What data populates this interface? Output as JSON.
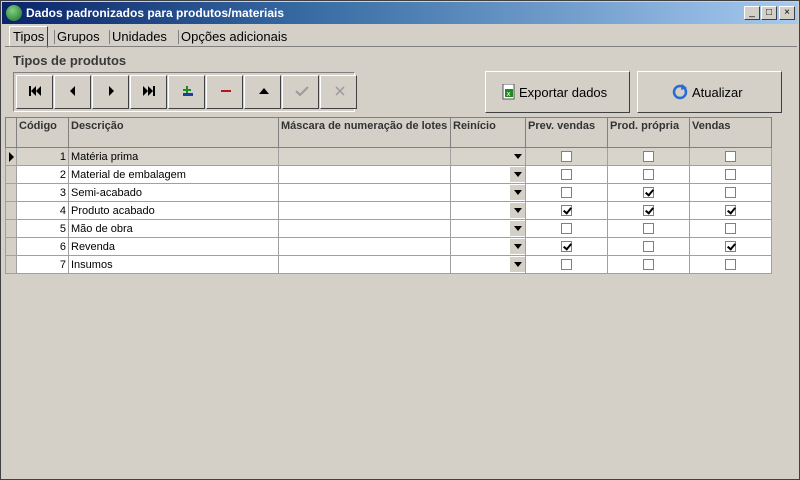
{
  "window": {
    "title": "Dados padronizados para produtos/materiais"
  },
  "tabs": [
    "Tipos",
    "Grupos",
    "Unidades",
    "Opções adicionais"
  ],
  "section": {
    "title": "Tipos de produtos"
  },
  "navigator": [
    "first-icon",
    "prior-icon",
    "next-icon",
    "last-icon",
    "insert-icon",
    "delete-icon",
    "edit-icon",
    "post-icon",
    "cancel-icon"
  ],
  "buttons": {
    "export": "Exportar dados",
    "refresh": "Atualizar"
  },
  "grid": {
    "columns": [
      "Código",
      "Descrição",
      "Máscara de numeração de lotes",
      "Reinício",
      "Prev. vendas",
      "Prod. própria",
      "Vendas"
    ],
    "rows": [
      {
        "codigo": "1",
        "descricao": "Matéria prima",
        "mascara": "",
        "reinicio": "",
        "prev_vendas": false,
        "prod_propria": false,
        "vendas": false
      },
      {
        "codigo": "2",
        "descricao": "Material de embalagem",
        "mascara": "",
        "reinicio": "",
        "prev_vendas": false,
        "prod_propria": false,
        "vendas": false
      },
      {
        "codigo": "3",
        "descricao": "Semi-acabado",
        "mascara": "",
        "reinicio": "",
        "prev_vendas": false,
        "prod_propria": true,
        "vendas": false
      },
      {
        "codigo": "4",
        "descricao": "Produto acabado",
        "mascara": "",
        "reinicio": "",
        "prev_vendas": true,
        "prod_propria": true,
        "vendas": true
      },
      {
        "codigo": "5",
        "descricao": "Mão de obra",
        "mascara": "",
        "reinicio": "",
        "prev_vendas": false,
        "prod_propria": false,
        "vendas": false
      },
      {
        "codigo": "6",
        "descricao": "Revenda",
        "mascara": "",
        "reinicio": "",
        "prev_vendas": true,
        "prod_propria": false,
        "vendas": true
      },
      {
        "codigo": "7",
        "descricao": "Insumos",
        "mascara": "",
        "reinicio": "",
        "prev_vendas": false,
        "prod_propria": false,
        "vendas": false
      }
    ],
    "selected_row": 0
  }
}
